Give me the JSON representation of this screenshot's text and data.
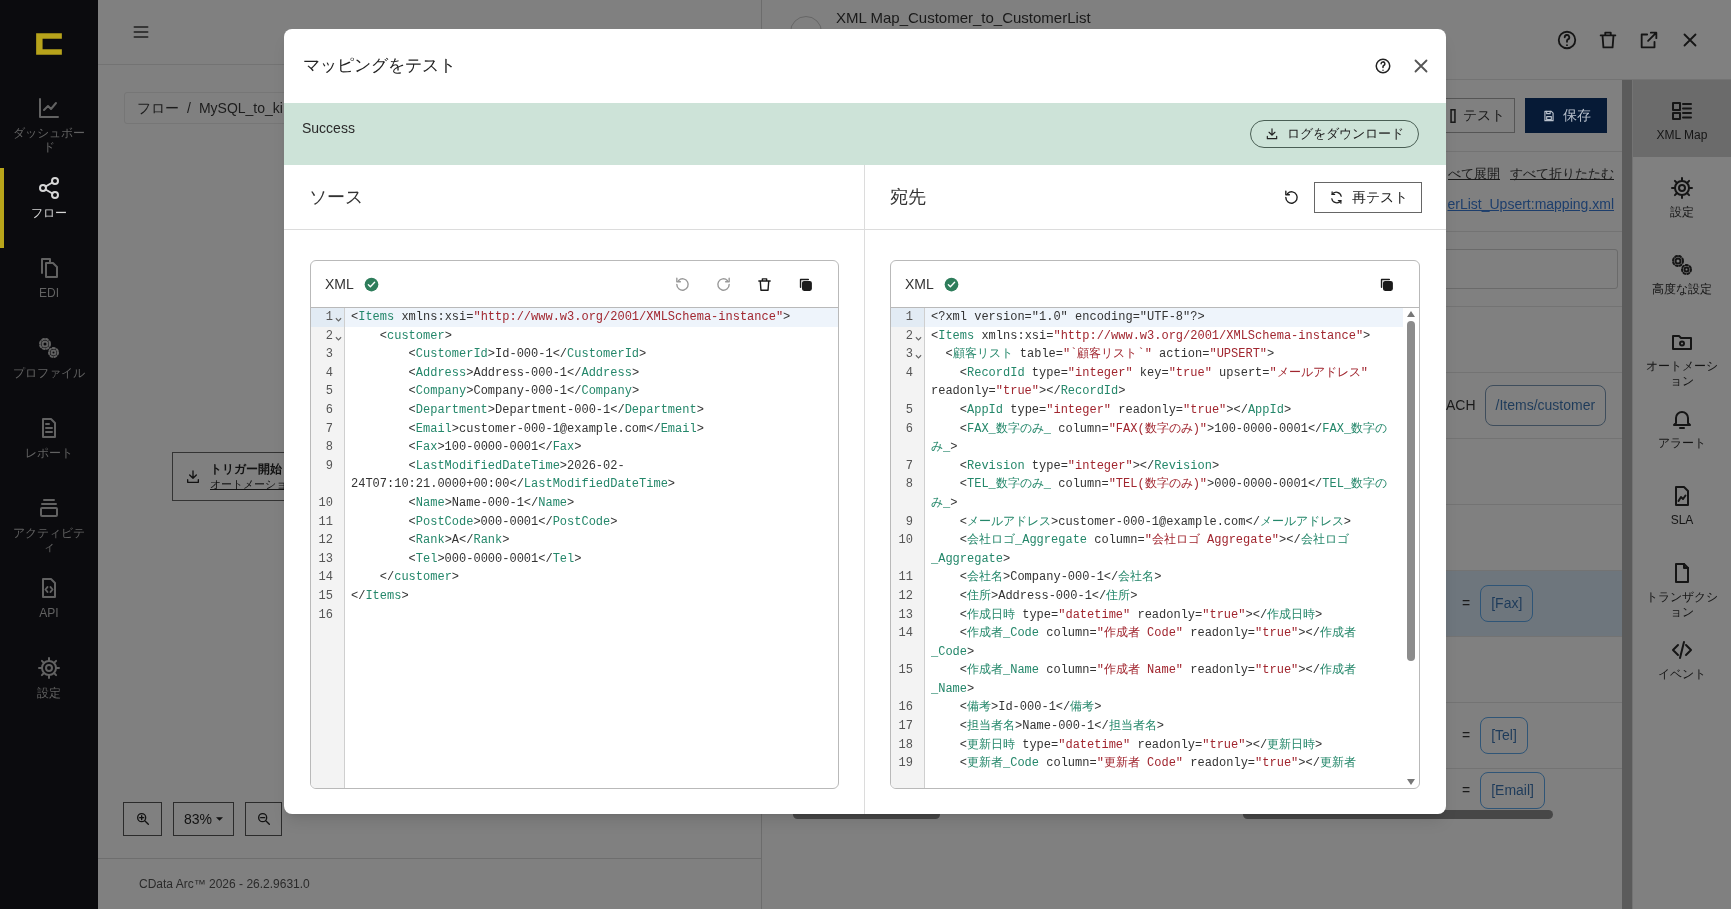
{
  "sidebar": {
    "items": [
      {
        "label": "ダッシュボード",
        "selected": false
      },
      {
        "label": "フロー",
        "selected": true
      },
      {
        "label": "EDI",
        "selected": false
      },
      {
        "label": "プロファイル",
        "selected": false
      },
      {
        "label": "レポート",
        "selected": false
      },
      {
        "label": "アクティビティ",
        "selected": false
      },
      {
        "label": "API",
        "selected": false
      },
      {
        "label": "設定",
        "selected": false
      }
    ]
  },
  "breadcrumb": [
    "フロー",
    "/",
    "MySQL_to_ki"
  ],
  "flow": {
    "trigger": {
      "title": "トリガー開始",
      "subtitle": "オートメーショ"
    },
    "zoom": "83%"
  },
  "footer": "CData Arc™ 2026 - 26.2.9631.0",
  "panel": {
    "title": "XML Map_Customer_to_CustomerList",
    "buttons": [
      {
        "label": "テスト",
        "kind": "outline"
      },
      {
        "label": "保存",
        "kind": "primary"
      }
    ],
    "links": [
      "べて展開",
      "すべて折りたたむ"
    ],
    "file_link": "erList_Upsert:mapping.xml",
    "rows": [
      {
        "kind": "empty",
        "selected": false
      },
      {
        "kind": "foreach",
        "label": "ACH",
        "value": "/Items/customer",
        "selected": false
      },
      {
        "kind": "empty",
        "selected": false
      },
      {
        "kind": "empty",
        "selected": false
      },
      {
        "kind": "mapping",
        "operator": "=",
        "value": "[Fax]",
        "selected": true
      },
      {
        "kind": "empty",
        "selected": false
      },
      {
        "kind": "mapping",
        "operator": "=",
        "value": "[Tel]",
        "selected": false
      },
      {
        "kind": "mapping",
        "operator": "=",
        "value": "[Email]",
        "selected": false
      }
    ]
  },
  "right_sidebar": {
    "items": [
      {
        "label": "XML Map",
        "selected": true
      },
      {
        "label": "設定",
        "selected": false
      },
      {
        "label": "高度な設定",
        "selected": false
      },
      {
        "label": "オートメーション",
        "selected": false
      },
      {
        "label": "アラート",
        "selected": false
      },
      {
        "label": "SLA",
        "selected": false
      },
      {
        "label": "トランザクション",
        "selected": false
      },
      {
        "label": "イベント",
        "selected": false
      }
    ]
  },
  "dialog": {
    "title": "マッピングをテスト",
    "status": {
      "text": "Success",
      "kind": "success"
    },
    "download_button": "ログをダウンロード",
    "source": {
      "title": "ソース",
      "editor": {
        "format": "XML",
        "valid": true,
        "lines": [
          {
            "n": "1",
            "fold": true,
            "active": true,
            "tokens": [
              {
                "kind": "plain",
                "text": "<"
              },
              {
                "kind": "tag",
                "text": "Items"
              },
              {
                "kind": "plain",
                "text": " xmlns:xsi="
              },
              {
                "kind": "string",
                "text": "\"http://www.w3.org/2001/XMLSchema-instance\""
              },
              {
                "kind": "plain",
                "text": ">"
              }
            ]
          },
          {
            "n": "2",
            "fold": true,
            "active": false,
            "tokens": [
              {
                "kind": "plain",
                "text": "    <"
              },
              {
                "kind": "tag",
                "text": "customer"
              },
              {
                "kind": "plain",
                "text": ">"
              }
            ]
          },
          {
            "n": "3",
            "fold": false,
            "active": false,
            "tokens": [
              {
                "kind": "plain",
                "text": "        <"
              },
              {
                "kind": "tag",
                "text": "CustomerId"
              },
              {
                "kind": "plain",
                "text": ">Id-000-1</"
              },
              {
                "kind": "tag",
                "text": "CustomerId"
              },
              {
                "kind": "plain",
                "text": ">"
              }
            ]
          },
          {
            "n": "4",
            "fold": false,
            "active": false,
            "tokens": [
              {
                "kind": "plain",
                "text": "        <"
              },
              {
                "kind": "tag",
                "text": "Address"
              },
              {
                "kind": "plain",
                "text": ">Address-000-1</"
              },
              {
                "kind": "tag",
                "text": "Address"
              },
              {
                "kind": "plain",
                "text": ">"
              }
            ]
          },
          {
            "n": "5",
            "fold": false,
            "active": false,
            "tokens": [
              {
                "kind": "plain",
                "text": "        <"
              },
              {
                "kind": "tag",
                "text": "Company"
              },
              {
                "kind": "plain",
                "text": ">Company-000-1</"
              },
              {
                "kind": "tag",
                "text": "Company"
              },
              {
                "kind": "plain",
                "text": ">"
              }
            ]
          },
          {
            "n": "6",
            "fold": false,
            "active": false,
            "tokens": [
              {
                "kind": "plain",
                "text": "        <"
              },
              {
                "kind": "tag",
                "text": "Department"
              },
              {
                "kind": "plain",
                "text": ">Department-000-1</"
              },
              {
                "kind": "tag",
                "text": "Department"
              },
              {
                "kind": "plain",
                "text": ">"
              }
            ]
          },
          {
            "n": "7",
            "fold": false,
            "active": false,
            "tokens": [
              {
                "kind": "plain",
                "text": "        <"
              },
              {
                "kind": "tag",
                "text": "Email"
              },
              {
                "kind": "plain",
                "text": ">customer-000-1@example.com</"
              },
              {
                "kind": "tag",
                "text": "Email"
              },
              {
                "kind": "plain",
                "text": ">"
              }
            ]
          },
          {
            "n": "8",
            "fold": false,
            "active": false,
            "tokens": [
              {
                "kind": "plain",
                "text": "        <"
              },
              {
                "kind": "tag",
                "text": "Fax"
              },
              {
                "kind": "plain",
                "text": ">100-0000-0001</"
              },
              {
                "kind": "tag",
                "text": "Fax"
              },
              {
                "kind": "plain",
                "text": ">"
              }
            ]
          },
          {
            "n": "9",
            "fold": false,
            "active": false,
            "tokens": [
              {
                "kind": "plain",
                "text": "        <"
              },
              {
                "kind": "tag",
                "text": "LastModifiedDateTime"
              },
              {
                "kind": "plain",
                "text": ">2026-02-24T07:10:21.0000+00:00</"
              },
              {
                "kind": "tag",
                "text": "LastModifiedDateTime"
              },
              {
                "kind": "plain",
                "text": ">"
              }
            ]
          },
          {
            "n": "10",
            "fold": false,
            "active": false,
            "tokens": [
              {
                "kind": "plain",
                "text": "        <"
              },
              {
                "kind": "tag",
                "text": "Name"
              },
              {
                "kind": "plain",
                "text": ">Name-000-1</"
              },
              {
                "kind": "tag",
                "text": "Name"
              },
              {
                "kind": "plain",
                "text": ">"
              }
            ]
          },
          {
            "n": "11",
            "fold": false,
            "active": false,
            "tokens": [
              {
                "kind": "plain",
                "text": "        <"
              },
              {
                "kind": "tag",
                "text": "PostCode"
              },
              {
                "kind": "plain",
                "text": ">000-0001</"
              },
              {
                "kind": "tag",
                "text": "PostCode"
              },
              {
                "kind": "plain",
                "text": ">"
              }
            ]
          },
          {
            "n": "12",
            "fold": false,
            "active": false,
            "tokens": [
              {
                "kind": "plain",
                "text": "        <"
              },
              {
                "kind": "tag",
                "text": "Rank"
              },
              {
                "kind": "plain",
                "text": ">A</"
              },
              {
                "kind": "tag",
                "text": "Rank"
              },
              {
                "kind": "plain",
                "text": ">"
              }
            ]
          },
          {
            "n": "13",
            "fold": false,
            "active": false,
            "tokens": [
              {
                "kind": "plain",
                "text": "        <"
              },
              {
                "kind": "tag",
                "text": "Tel"
              },
              {
                "kind": "plain",
                "text": ">000-0000-0001</"
              },
              {
                "kind": "tag",
                "text": "Tel"
              },
              {
                "kind": "plain",
                "text": ">"
              }
            ]
          },
          {
            "n": "14",
            "fold": false,
            "active": false,
            "tokens": [
              {
                "kind": "plain",
                "text": "    </"
              },
              {
                "kind": "tag",
                "text": "customer"
              },
              {
                "kind": "plain",
                "text": ">"
              }
            ]
          },
          {
            "n": "15",
            "fold": false,
            "active": false,
            "tokens": [
              {
                "kind": "plain",
                "text": "</"
              },
              {
                "kind": "tag",
                "text": "Items"
              },
              {
                "kind": "plain",
                "text": ">"
              }
            ]
          },
          {
            "n": "16",
            "fold": false,
            "active": false
          }
        ]
      }
    },
    "target": {
      "title": "宛先",
      "retest_button": "再テスト",
      "editor": {
        "format": "XML",
        "valid": true,
        "lines": [
          {
            "n": "1",
            "fold": false,
            "active": true,
            "tokens": [
              {
                "kind": "plain",
                "text": "<?xml version=\"1.0\" encoding=\"UTF-8\"?>"
              }
            ]
          },
          {
            "n": "2",
            "fold": true,
            "active": false,
            "tokens": [
              {
                "kind": "plain",
                "text": "<"
              },
              {
                "kind": "tag",
                "text": "Items"
              },
              {
                "kind": "plain",
                "text": " xmlns:xsi="
              },
              {
                "kind": "string",
                "text": "\"http://www.w3.org/2001/XMLSchema-instance\""
              },
              {
                "kind": "plain",
                "text": ">"
              }
            ]
          },
          {
            "n": "3",
            "fold": true,
            "active": false,
            "tokens": [
              {
                "kind": "plain",
                "text": "  <"
              },
              {
                "kind": "tag",
                "text": "顧客リスト"
              },
              {
                "kind": "plain",
                "text": " table="
              },
              {
                "kind": "string",
                "text": "\"`顧客リスト`\""
              },
              {
                "kind": "plain",
                "text": " action="
              },
              {
                "kind": "string",
                "text": "\"UPSERT\""
              },
              {
                "kind": "plain",
                "text": ">"
              }
            ]
          },
          {
            "n": "4",
            "fold": false,
            "active": false,
            "tokens": [
              {
                "kind": "plain",
                "text": "    <"
              },
              {
                "kind": "tag",
                "text": "RecordId"
              },
              {
                "kind": "plain",
                "text": " type="
              },
              {
                "kind": "string",
                "text": "\"integer\""
              },
              {
                "kind": "plain",
                "text": " key="
              },
              {
                "kind": "string",
                "text": "\"true\""
              },
              {
                "kind": "plain",
                "text": " upsert="
              },
              {
                "kind": "string",
                "text": "\"メールアドレス\""
              },
              {
                "kind": "plain",
                "text": " readonly="
              },
              {
                "kind": "string",
                "text": "\"true\""
              },
              {
                "kind": "plain",
                "text": "></"
              },
              {
                "kind": "tag",
                "text": "RecordId"
              },
              {
                "kind": "plain",
                "text": ">"
              }
            ]
          },
          {
            "n": "5",
            "fold": false,
            "active": false,
            "tokens": [
              {
                "kind": "plain",
                "text": "    <"
              },
              {
                "kind": "tag",
                "text": "AppId"
              },
              {
                "kind": "plain",
                "text": " type="
              },
              {
                "kind": "string",
                "text": "\"integer\""
              },
              {
                "kind": "plain",
                "text": " readonly="
              },
              {
                "kind": "string",
                "text": "\"true\""
              },
              {
                "kind": "plain",
                "text": "></"
              },
              {
                "kind": "tag",
                "text": "AppId"
              },
              {
                "kind": "plain",
                "text": ">"
              }
            ]
          },
          {
            "n": "6",
            "fold": false,
            "active": false,
            "tokens": [
              {
                "kind": "plain",
                "text": "    <"
              },
              {
                "kind": "tag",
                "text": "FAX_数字のみ_"
              },
              {
                "kind": "plain",
                "text": " column="
              },
              {
                "kind": "string",
                "text": "\"FAX(数字のみ)\""
              },
              {
                "kind": "plain",
                "text": ">100-0000-0001</"
              },
              {
                "kind": "tag",
                "text": "FAX_数字のみ_"
              },
              {
                "kind": "plain",
                "text": ">"
              }
            ]
          },
          {
            "n": "7",
            "fold": false,
            "active": false,
            "tokens": [
              {
                "kind": "plain",
                "text": "    <"
              },
              {
                "kind": "tag",
                "text": "Revision"
              },
              {
                "kind": "plain",
                "text": " type="
              },
              {
                "kind": "string",
                "text": "\"integer\""
              },
              {
                "kind": "plain",
                "text": "></"
              },
              {
                "kind": "tag",
                "text": "Revision"
              },
              {
                "kind": "plain",
                "text": ">"
              }
            ]
          },
          {
            "n": "8",
            "fold": false,
            "active": false,
            "tokens": [
              {
                "kind": "plain",
                "text": "    <"
              },
              {
                "kind": "tag",
                "text": "TEL_数字のみ_"
              },
              {
                "kind": "plain",
                "text": " column="
              },
              {
                "kind": "string",
                "text": "\"TEL(数字のみ)\""
              },
              {
                "kind": "plain",
                "text": ">000-0000-0001</"
              },
              {
                "kind": "tag",
                "text": "TEL_数字のみ_"
              },
              {
                "kind": "plain",
                "text": ">"
              }
            ]
          },
          {
            "n": "9",
            "fold": false,
            "active": false,
            "tokens": [
              {
                "kind": "plain",
                "text": "    <"
              },
              {
                "kind": "tag",
                "text": "メールアドレス"
              },
              {
                "kind": "plain",
                "text": ">customer-000-1@example.com</"
              },
              {
                "kind": "tag",
                "text": "メールアドレス"
              },
              {
                "kind": "plain",
                "text": ">"
              }
            ]
          },
          {
            "n": "10",
            "fold": false,
            "active": false,
            "tokens": [
              {
                "kind": "plain",
                "text": "    <"
              },
              {
                "kind": "tag",
                "text": "会社ロゴ_Aggregate"
              },
              {
                "kind": "plain",
                "text": " column="
              },
              {
                "kind": "string",
                "text": "\"会社ロゴ Aggregate\""
              },
              {
                "kind": "plain",
                "text": "></"
              },
              {
                "kind": "tag",
                "text": "会社ロゴ_Aggregate"
              },
              {
                "kind": "plain",
                "text": ">"
              }
            ]
          },
          {
            "n": "11",
            "fold": false,
            "active": false,
            "tokens": [
              {
                "kind": "plain",
                "text": "    <"
              },
              {
                "kind": "tag",
                "text": "会社名"
              },
              {
                "kind": "plain",
                "text": ">Company-000-1</"
              },
              {
                "kind": "tag",
                "text": "会社名"
              },
              {
                "kind": "plain",
                "text": ">"
              }
            ]
          },
          {
            "n": "12",
            "fold": false,
            "active": false,
            "tokens": [
              {
                "kind": "plain",
                "text": "    <"
              },
              {
                "kind": "tag",
                "text": "住所"
              },
              {
                "kind": "plain",
                "text": ">Address-000-1</"
              },
              {
                "kind": "tag",
                "text": "住所"
              },
              {
                "kind": "plain",
                "text": ">"
              }
            ]
          },
          {
            "n": "13",
            "fold": false,
            "active": false,
            "tokens": [
              {
                "kind": "plain",
                "text": "    <"
              },
              {
                "kind": "tag",
                "text": "作成日時"
              },
              {
                "kind": "plain",
                "text": " type="
              },
              {
                "kind": "string",
                "text": "\"datetime\""
              },
              {
                "kind": "plain",
                "text": " readonly="
              },
              {
                "kind": "string",
                "text": "\"true\""
              },
              {
                "kind": "plain",
                "text": "></"
              },
              {
                "kind": "tag",
                "text": "作成日時"
              },
              {
                "kind": "plain",
                "text": ">"
              }
            ]
          },
          {
            "n": "14",
            "fold": false,
            "active": false,
            "tokens": [
              {
                "kind": "plain",
                "text": "    <"
              },
              {
                "kind": "tag",
                "text": "作成者_Code"
              },
              {
                "kind": "plain",
                "text": " column="
              },
              {
                "kind": "string",
                "text": "\"作成者 Code\""
              },
              {
                "kind": "plain",
                "text": " readonly="
              },
              {
                "kind": "string",
                "text": "\"true\""
              },
              {
                "kind": "plain",
                "text": "></"
              },
              {
                "kind": "tag",
                "text": "作成者_Code"
              },
              {
                "kind": "plain",
                "text": ">"
              }
            ]
          },
          {
            "n": "15",
            "fold": false,
            "active": false,
            "tokens": [
              {
                "kind": "plain",
                "text": "    <"
              },
              {
                "kind": "tag",
                "text": "作成者_Name"
              },
              {
                "kind": "plain",
                "text": " column="
              },
              {
                "kind": "string",
                "text": "\"作成者 Name\""
              },
              {
                "kind": "plain",
                "text": " readonly="
              },
              {
                "kind": "string",
                "text": "\"true\""
              },
              {
                "kind": "plain",
                "text": "></"
              },
              {
                "kind": "tag",
                "text": "作成者_Name"
              },
              {
                "kind": "plain",
                "text": ">"
              }
            ]
          },
          {
            "n": "16",
            "fold": false,
            "active": false,
            "tokens": [
              {
                "kind": "plain",
                "text": "    <"
              },
              {
                "kind": "tag",
                "text": "備考"
              },
              {
                "kind": "plain",
                "text": ">Id-000-1</"
              },
              {
                "kind": "tag",
                "text": "備考"
              },
              {
                "kind": "plain",
                "text": ">"
              }
            ]
          },
          {
            "n": "17",
            "fold": false,
            "active": false,
            "tokens": [
              {
                "kind": "plain",
                "text": "    <"
              },
              {
                "kind": "tag",
                "text": "担当者名"
              },
              {
                "kind": "plain",
                "text": ">Name-000-1</"
              },
              {
                "kind": "tag",
                "text": "担当者名"
              },
              {
                "kind": "plain",
                "text": ">"
              }
            ]
          },
          {
            "n": "18",
            "fold": false,
            "active": false,
            "tokens": [
              {
                "kind": "plain",
                "text": "    <"
              },
              {
                "kind": "tag",
                "text": "更新日時"
              },
              {
                "kind": "plain",
                "text": " type="
              },
              {
                "kind": "string",
                "text": "\"datetime\""
              },
              {
                "kind": "plain",
                "text": " readonly="
              },
              {
                "kind": "string",
                "text": "\"true\""
              },
              {
                "kind": "plain",
                "text": "></"
              },
              {
                "kind": "tag",
                "text": "更新日時"
              },
              {
                "kind": "plain",
                "text": ">"
              }
            ]
          },
          {
            "n": "19",
            "fold": false,
            "active": false,
            "tokens": [
              {
                "kind": "plain",
                "text": "    <"
              },
              {
                "kind": "tag",
                "text": "更新者_Code"
              },
              {
                "kind": "plain",
                "text": " column="
              },
              {
                "kind": "string",
                "text": "\"更新者 Code\""
              },
              {
                "kind": "plain",
                "text": " readonly="
              },
              {
                "kind": "string",
                "text": "\"true\""
              },
              {
                "kind": "plain",
                "text": "></"
              },
              {
                "kind": "tag",
                "text": "更新者"
              }
            ]
          }
        ]
      }
    }
  }
}
